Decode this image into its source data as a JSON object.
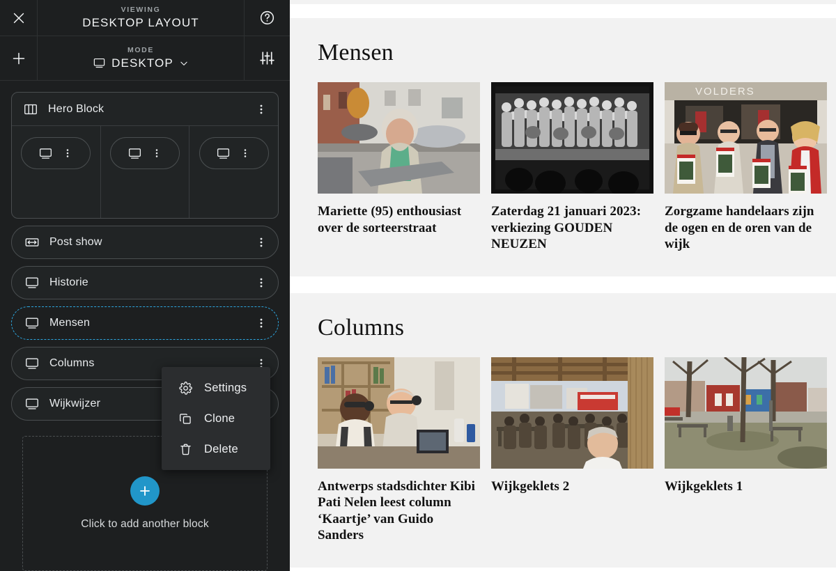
{
  "sidebar": {
    "close_icon": "close-icon",
    "add_icon": "plus-icon",
    "help_icon": "help-circle-icon",
    "tune_icon": "sliders-icon",
    "viewing_kicker": "VIEWING",
    "viewing_title": "DESKTOP LAYOUT",
    "mode_kicker": "MODE",
    "mode_value": "DESKTOP",
    "mode_chevron": "chevron-down-icon",
    "hero": {
      "label": "Hero Block",
      "icon": "columns-icon",
      "more_icon": "more-vertical-icon",
      "columns": [
        {
          "icon": "desktop-icon",
          "more_icon": "more-vertical-icon"
        },
        {
          "icon": "desktop-icon",
          "more_icon": "more-vertical-icon"
        },
        {
          "icon": "desktop-icon",
          "more_icon": "more-vertical-icon"
        }
      ]
    },
    "blocks": [
      {
        "label": "Post show",
        "icon": "resize-horizontal-icon",
        "selected": false
      },
      {
        "label": "Historie",
        "icon": "desktop-icon",
        "selected": false
      },
      {
        "label": "Mensen",
        "icon": "desktop-icon",
        "selected": true
      },
      {
        "label": "Columns",
        "icon": "desktop-icon",
        "selected": false
      },
      {
        "label": "Wijkwijzer",
        "icon": "desktop-icon",
        "selected": false
      }
    ],
    "add_block_text": "Click to add another block",
    "context_menu": [
      {
        "label": "Settings",
        "icon": "gear-icon"
      },
      {
        "label": "Clone",
        "icon": "copy-icon"
      },
      {
        "label": "Delete",
        "icon": "trash-icon"
      }
    ]
  },
  "preview": {
    "sections": [
      {
        "title": "Mensen",
        "cards": [
          {
            "title": "Mariette (95) enthousiast over de sorteerstraat",
            "image": "elderly-woman-street-photo"
          },
          {
            "title": "Zaterdag 21 januari 2023: verkiezing GOUDEN NEUZEN",
            "image": "group-on-stage-bw-photo"
          },
          {
            "title": "Zorgzame handelaars zijn de ogen en de oren van de wijk",
            "image": "four-people-flyers-volders-shop-photo"
          }
        ]
      },
      {
        "title": "Columns",
        "cards": [
          {
            "title": "Antwerps stadsdichter Kibi Pati Nelen leest column ‘Kaartje’ van Guido Sanders",
            "image": "two-men-at-desk-photo"
          },
          {
            "title": "Wijkgeklets 2",
            "image": "community-gathering-pavilion-photo"
          },
          {
            "title": "Wijkgeklets 1",
            "image": "town-square-benches-photo"
          }
        ]
      }
    ]
  },
  "colors": {
    "sidebar_bg": "#1d1f20",
    "accent": "#2196c9",
    "selection": "#2da7e0",
    "section_bg": "#f2f2f2",
    "menu_bg": "#2b2d2f"
  }
}
